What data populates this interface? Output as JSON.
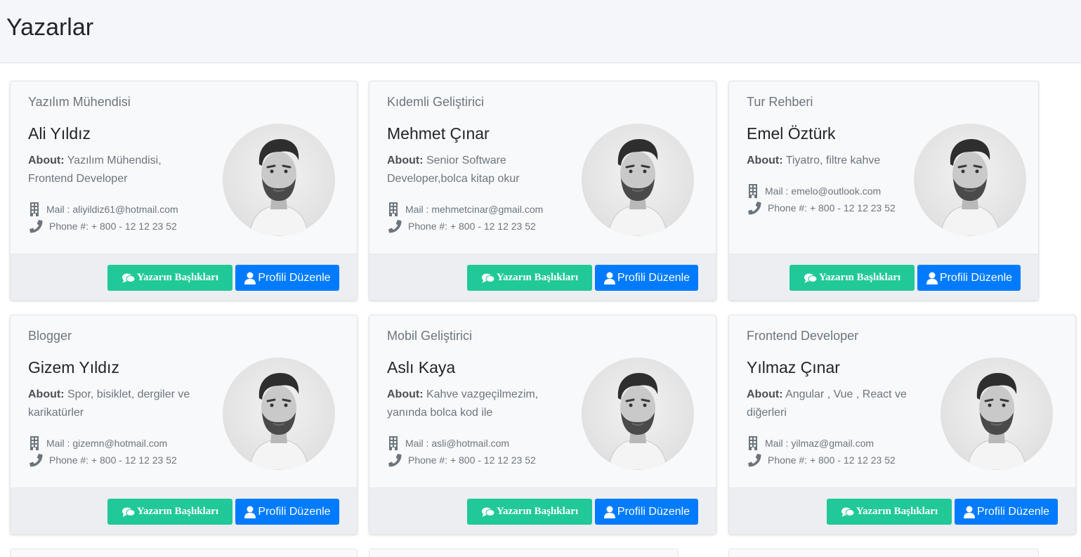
{
  "page": {
    "title": "Yazarlar"
  },
  "labels": {
    "about": "About:",
    "mail": "Mail :",
    "phone": "Phone #:",
    "titles_button": "Yazarın Başlıkları",
    "edit_button": "Profili Düzenle"
  },
  "colors": {
    "green_button": "#20c997",
    "blue_button": "#007bff",
    "header_bg": "#f4f6f9"
  },
  "icons": {
    "titles_button": "comments-icon",
    "edit_button": "user-icon",
    "mail": "building-icon",
    "phone": "phone-icon"
  },
  "authors": [
    {
      "role": "Yazılım Mühendisi",
      "name": "Ali Yıldız",
      "about": "Yazılım Mühendisi, Frontend Developer",
      "mail": "aliyildiz61@hotmail.com",
      "phone": "+ 800 - 12 12 23 52"
    },
    {
      "role": "Kıdemli Geliştirici",
      "name": "Mehmet Çınar",
      "about": "Senior Software Developer,bolca kitap okur",
      "mail": "mehmetcinar@gmail.com",
      "phone": "+ 800 - 12 12 23 52"
    },
    {
      "role": "Tur Rehberi",
      "name": "Emel Öztürk",
      "about": "Tiyatro, filtre kahve",
      "mail": "emelo@outlook.com",
      "phone": "+ 800 - 12 12 23 52"
    },
    {
      "role": "Blogger",
      "name": "Gizem Yıldız",
      "about": "Spor, bisiklet, dergiler ve karikatürler",
      "mail": "gizemn@hotmail.com",
      "phone": "+ 800 - 12 12 23 52"
    },
    {
      "role": "Mobil Geliştirici",
      "name": "Aslı Kaya",
      "about": "Kahve vazgeçilmezim, yanında bolca kod ile",
      "mail": "asli@hotmail.com",
      "phone": "+ 800 - 12 12 23 52"
    },
    {
      "role": "Frontend Developer",
      "name": "Yılmaz Çınar",
      "about": "Angular , Vue , React ve diğerleri",
      "mail": "yilmaz@gmail.com",
      "phone": "+ 800 - 12 12 23 52"
    }
  ]
}
